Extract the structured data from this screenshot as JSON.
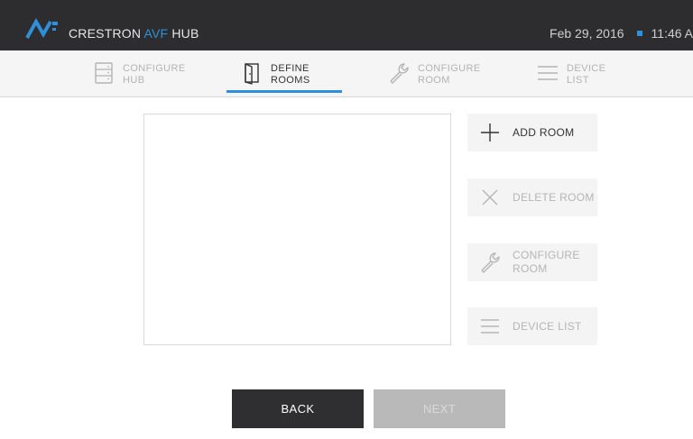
{
  "header": {
    "brand_prefix": "CRESTRON ",
    "brand_accent": "AVF",
    "brand_suffix": " HUB",
    "date": "Feb 29, 2016",
    "time": "11:46 A",
    "accent_color": "#2f8fd8"
  },
  "tabs": [
    {
      "label": "CONFIGURE\nHUB",
      "icon": "server-icon",
      "state": "inactive"
    },
    {
      "label": "DEFINE\nROOMS",
      "icon": "door-icon",
      "state": "active"
    },
    {
      "label": "CONFIGURE\nROOM",
      "icon": "wrench-icon",
      "state": "inactive"
    },
    {
      "label": "DEVICE\nLIST",
      "icon": "list-icon",
      "state": "inactive"
    }
  ],
  "actions": [
    {
      "label": "ADD ROOM",
      "icon": "plus-icon",
      "enabled": true
    },
    {
      "label": "DELETE ROOM",
      "icon": "close-icon",
      "enabled": false
    },
    {
      "label": "CONFIGURE\nROOM",
      "icon": "wrench-icon",
      "enabled": false
    },
    {
      "label": "DEVICE LIST",
      "icon": "list-icon",
      "enabled": false
    }
  ],
  "footer": {
    "back_label": "BACK",
    "next_label": "NEXT",
    "next_enabled": false
  }
}
